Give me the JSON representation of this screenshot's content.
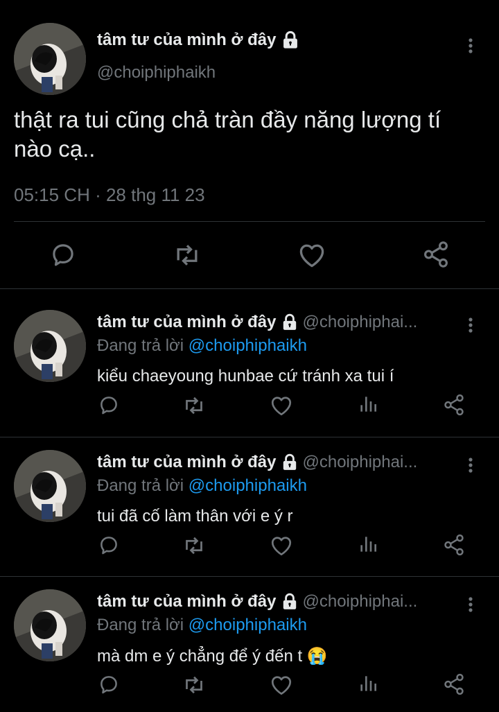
{
  "main_tweet": {
    "display_name": "tâm tư của mình ở đây",
    "handle": "@choiphiphaikh",
    "text": "thật ra tui cũng chả tràn đầy năng lượng tí nào cạ..",
    "timestamp": "05:15 CH · 28 thg 11 23"
  },
  "replies": [
    {
      "display_name": "tâm tư của mình ở đây",
      "handle": "@choiphiphai...",
      "replying_prefix": "Đang trả lời",
      "replying_to": "@choiphiphaikh",
      "text": "kiểu chaeyoung hunbae cứ tránh xa tui í"
    },
    {
      "display_name": "tâm tư của mình ở đây",
      "handle": "@choiphiphai...",
      "replying_prefix": "Đang trả lời",
      "replying_to": "@choiphiphaikh",
      "text": "tui đã cố làm thân với e ý r"
    },
    {
      "display_name": "tâm tư của mình ở đây",
      "handle": "@choiphiphai...",
      "replying_prefix": "Đang trả lời",
      "replying_to": "@choiphiphaikh",
      "text": "mà dm e ý chẳng để ý đến t 😭"
    }
  ],
  "icons": [
    "lock-icon",
    "more-icon",
    "reply-icon",
    "retweet-icon",
    "like-icon",
    "views-icon",
    "share-icon"
  ],
  "colors": {
    "background": "#000000",
    "text": "#e7e9ea",
    "muted": "#71767b",
    "link": "#1d9bf0",
    "divider": "#2f3336"
  }
}
